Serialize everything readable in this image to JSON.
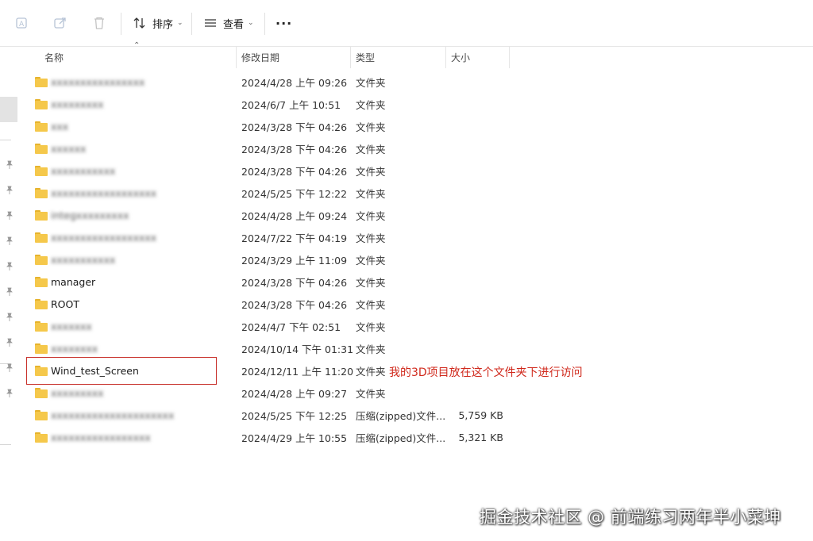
{
  "toolbar": {
    "sort_label": "排序",
    "view_label": "查看",
    "more_label": "···"
  },
  "columns": {
    "name": "名称",
    "modified": "修改日期",
    "type": "类型",
    "size": "大小"
  },
  "rows": [
    {
      "name": "",
      "blurred": true,
      "date": "2024/4/28 上午 09:26",
      "type": "文件夹",
      "size": ""
    },
    {
      "name": "",
      "blurred": true,
      "date": "2024/6/7 上午 10:51",
      "type": "文件夹",
      "size": ""
    },
    {
      "name": "",
      "blurred": true,
      "date": "2024/3/28 下午 04:26",
      "type": "文件夹",
      "size": ""
    },
    {
      "name": "",
      "blurred": true,
      "date": "2024/3/28 下午 04:26",
      "type": "文件夹",
      "size": ""
    },
    {
      "name": "",
      "blurred": true,
      "date": "2024/3/28 下午 04:26",
      "type": "文件夹",
      "size": ""
    },
    {
      "name": "",
      "blurred": true,
      "date": "2024/5/25 下午 12:22",
      "type": "文件夹",
      "size": ""
    },
    {
      "name": "",
      "blurred": true,
      "date": "2024/4/28 上午 09:24",
      "type": "文件夹",
      "size": ""
    },
    {
      "name": "",
      "blurred": true,
      "date": "2024/7/22 下午 04:19",
      "type": "文件夹",
      "size": ""
    },
    {
      "name": "",
      "blurred": true,
      "date": "2024/3/29 上午 11:09",
      "type": "文件夹",
      "size": ""
    },
    {
      "name": "manager",
      "blurred": false,
      "date": "2024/3/28 下午 04:26",
      "type": "文件夹",
      "size": ""
    },
    {
      "name": "ROOT",
      "blurred": false,
      "date": "2024/3/28 下午 04:26",
      "type": "文件夹",
      "size": ""
    },
    {
      "name": "",
      "blurred": true,
      "date": "2024/4/7 下午 02:51",
      "type": "文件夹",
      "size": ""
    },
    {
      "name": "",
      "blurred": true,
      "date": "2024/10/14 下午 01:31",
      "type": "文件夹",
      "size": ""
    },
    {
      "name": "Wind_test_Screen",
      "blurred": false,
      "date": "2024/12/11 上午 11:20",
      "type": "文件夹",
      "size": ""
    },
    {
      "name": "",
      "blurred": true,
      "date": "2024/4/28 上午 09:27",
      "type": "文件夹",
      "size": ""
    },
    {
      "name": "",
      "blurred": true,
      "date": "2024/5/25 下午 12:25",
      "type": "压缩(zipped)文件...",
      "size": "5,759 KB"
    },
    {
      "name": "",
      "blurred": true,
      "date": "2024/4/29 上午 10:55",
      "type": "压缩(zipped)文件...",
      "size": "5,321 KB"
    }
  ],
  "annotation": "我的3D项目放在这个文件夹下进行访问",
  "watermark": "掘金技术社区 @ 前端练习两年半小菜坤",
  "colors": {
    "folder": "#f5c84b",
    "highlight": "#c8312b",
    "annotation_text": "#d0291c"
  }
}
